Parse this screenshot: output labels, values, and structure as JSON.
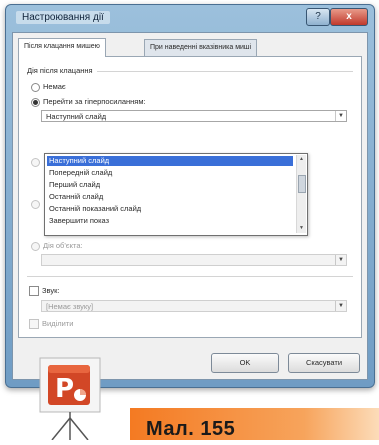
{
  "dialog": {
    "title": "Настроювання дії",
    "help_button": "?",
    "close_button": "x"
  },
  "tabs": [
    {
      "label": "Після клацання мишею"
    },
    {
      "label": "При наведенні вказівника миші"
    }
  ],
  "section": {
    "label": "Дія після клацання",
    "radio_none": "Немає",
    "radio_hyperlink": "Перейти за гіперпосиланням:",
    "radio_object": "Дія об'єкта:"
  },
  "hyperlink_combo": {
    "value": "Наступний слайд"
  },
  "dropdown": {
    "items": [
      {
        "label": "Наступний слайд",
        "selected": true
      },
      {
        "label": "Попередній слайд",
        "selected": false
      },
      {
        "label": "Перший слайд",
        "selected": false
      },
      {
        "label": "Останній слайд",
        "selected": false
      },
      {
        "label": "Останній показаний слайд",
        "selected": false
      },
      {
        "label": "Завершити показ",
        "selected": false
      }
    ]
  },
  "sound": {
    "label": "Звук:",
    "combo_value": "[Немає звуку]"
  },
  "highlight": {
    "label": "Виділити"
  },
  "buttons": {
    "ok": "OK",
    "cancel": "Скасувати"
  },
  "footer": {
    "caption": "Мал. 155"
  },
  "colors": {
    "accent_orange": "#f47a22",
    "selection_blue": "#3a6fd8",
    "title_bar": "#6f9cc4"
  }
}
